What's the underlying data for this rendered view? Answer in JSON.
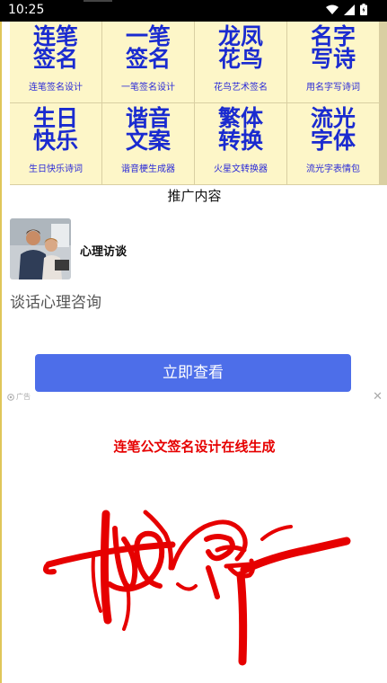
{
  "status_bar": {
    "time": "10:25"
  },
  "tools": [
    {
      "icon_lines": [
        "连笔",
        "签名"
      ],
      "label": "连笔签名设计"
    },
    {
      "icon_lines": [
        "一笔",
        "签名"
      ],
      "label": "一笔签名设计"
    },
    {
      "icon_lines": [
        "龙凤",
        "花鸟"
      ],
      "label": "花鸟艺术签名"
    },
    {
      "icon_lines": [
        "名字",
        "写诗"
      ],
      "label": "用名字写诗词"
    },
    {
      "icon_lines": [
        "生日",
        "快乐"
      ],
      "label": "生日快乐诗词"
    },
    {
      "icon_lines": [
        "谐音",
        "文案"
      ],
      "label": "谐音梗生成器"
    },
    {
      "icon_lines": [
        "繁体",
        "转换"
      ],
      "label": "火星文转换器"
    },
    {
      "icon_lines": [
        "流光",
        "字体"
      ],
      "label": "流光字表情包"
    }
  ],
  "promo": {
    "title": "推广内容"
  },
  "ad": {
    "name": "心理访谈",
    "description": "谈话心理咨询",
    "cta": "立即查看",
    "tag": "广告",
    "close": "✕"
  },
  "section": {
    "title": "连笔公文签名设计在线生成"
  },
  "colors": {
    "tool_bg": "#fdf6c8",
    "tool_text": "#1a2bd0",
    "cta_bg": "#4d6ee9",
    "section_title": "#e60000",
    "signature": "#e60000"
  }
}
